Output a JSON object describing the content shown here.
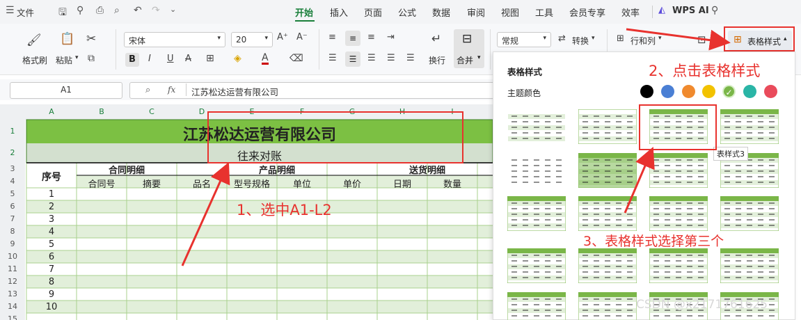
{
  "menubar": {
    "file": "文件",
    "tabs": [
      "开始",
      "插入",
      "页面",
      "公式",
      "数据",
      "审阅",
      "视图",
      "工具",
      "会员专享",
      "效率"
    ],
    "wps_ai": "WPS AI"
  },
  "ribbon": {
    "format_painter": "格式刷",
    "paste": "粘贴",
    "font_name": "宋体",
    "font_size": "20",
    "wrap": "换行",
    "merge": "合并",
    "number_format": "常规",
    "convert": "转换",
    "row_col": "行和列",
    "table_style": "表格样式"
  },
  "formula_bar": {
    "cell_ref": "A1",
    "fx": "fx",
    "content": "江苏松达运营有限公司"
  },
  "sheet": {
    "columns": [
      "A",
      "B",
      "C",
      "D",
      "E",
      "F",
      "G",
      "H",
      "I"
    ],
    "rows": [
      "1",
      "2",
      "3",
      "4",
      "5",
      "6",
      "7",
      "8",
      "9",
      "10",
      "11",
      "12",
      "13",
      "14",
      "15"
    ],
    "title": "江苏松达运营有限公司",
    "subtitle": "往来对账",
    "seq_header": "序号",
    "group_contract": "合同明细",
    "group_product": "产品明细",
    "group_delivery": "送货明细",
    "sub_headers": [
      "合同号",
      "摘要",
      "品名",
      "型号规格",
      "单位",
      "单价",
      "日期",
      "数量"
    ],
    "seq_values": [
      "1",
      "2",
      "3",
      "4",
      "5",
      "6",
      "7",
      "8",
      "9",
      "10"
    ]
  },
  "panel": {
    "title": "表格样式",
    "theme_label": "主题颜色",
    "tooltip": "表样式3",
    "colors": [
      "#000000",
      "#4a7fd4",
      "#f08a2e",
      "#f2c200",
      "#7ab648",
      "#2ab5a6",
      "#e94b5b"
    ]
  },
  "annotations": {
    "step1": "1、选中A1-L2",
    "step2": "2、点击表格样式",
    "step3": "3、表格样式选择第三个"
  },
  "watermark": "CSDN @x2171761625"
}
